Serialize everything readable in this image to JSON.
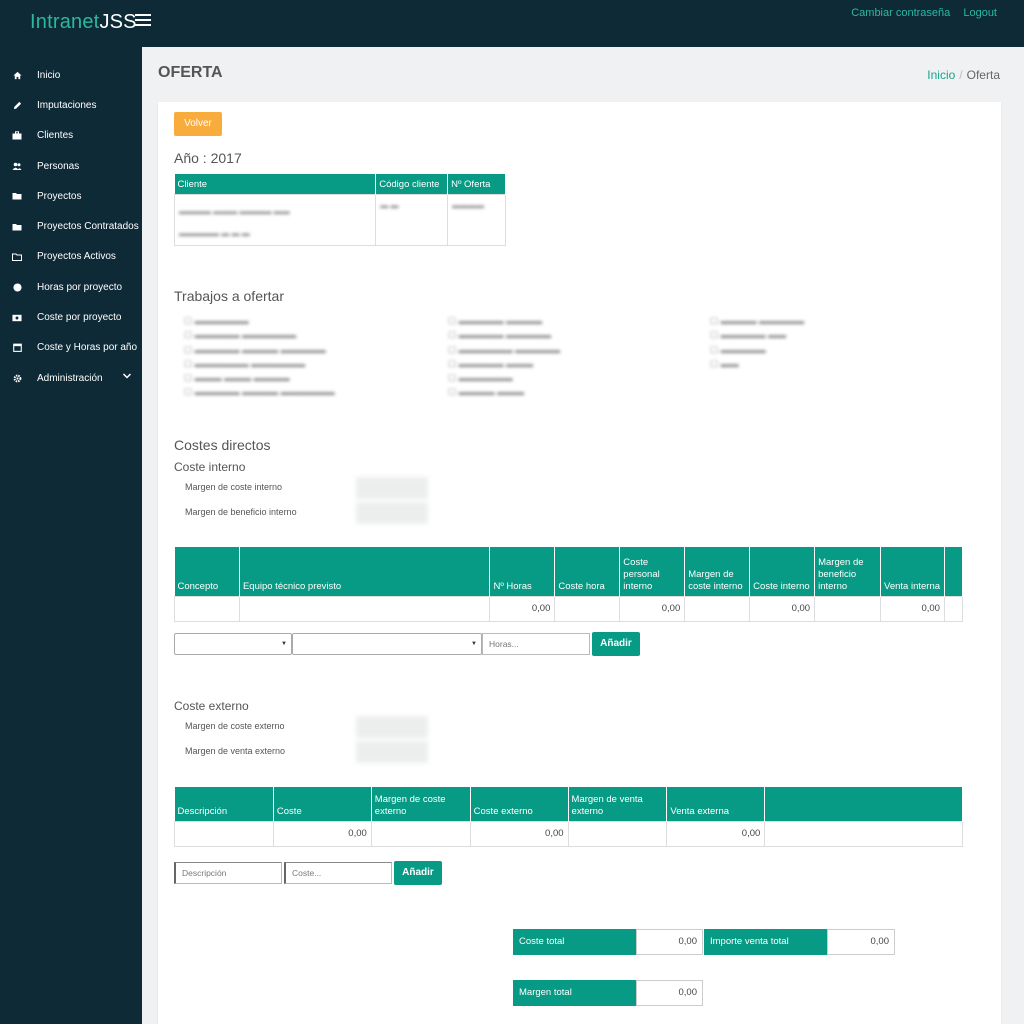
{
  "header": {
    "brand_prefix": "Intranet",
    "brand_suffix": "JSS",
    "change_password": "Cambiar contraseña",
    "logout": "Logout"
  },
  "sidebar": {
    "items": [
      {
        "label": "Inicio",
        "icon": "home-icon"
      },
      {
        "label": "Imputaciones",
        "icon": "pencil-icon"
      },
      {
        "label": "Clientes",
        "icon": "briefcase-icon"
      },
      {
        "label": "Personas",
        "icon": "users-icon"
      },
      {
        "label": "Proyectos",
        "icon": "folder-icon"
      },
      {
        "label": "Proyectos Contratados",
        "icon": "folder-icon"
      },
      {
        "label": "Proyectos Activos",
        "icon": "folder-open-icon"
      },
      {
        "label": "Horas por proyecto",
        "icon": "clock-icon"
      },
      {
        "label": "Coste por proyecto",
        "icon": "money-icon"
      },
      {
        "label": "Coste y Horas por año",
        "icon": "calendar-icon"
      },
      {
        "label": "Administración",
        "icon": "gear-icon"
      }
    ]
  },
  "page": {
    "title": "OFERTA",
    "breadcrumb_home": "Inicio",
    "breadcrumb_sep": "/",
    "breadcrumb_current": "Oferta"
  },
  "form": {
    "back_button": "Volver",
    "year_heading": "Año : 2017",
    "client_table": {
      "headers": [
        "Cliente",
        "Código cliente",
        "Nº Oferta"
      ]
    },
    "trabajos_heading": "Trabajos a ofertar",
    "costes_directos_heading": "Costes directos",
    "coste_interno_heading": "Coste interno",
    "margen_coste_interno_label": "Margen de coste interno",
    "margen_beneficio_interno_label": "Margen de beneficio interno",
    "internal_table": {
      "headers": [
        "Concepto",
        "Equipo técnico previsto",
        "Nº Horas",
        "Coste hora",
        "Coste personal interno",
        "Margen de coste interno",
        "Coste interno",
        "Margen de beneficio interno",
        "Venta interna",
        ""
      ],
      "row": [
        "",
        "",
        "0,00",
        "",
        "0,00",
        "",
        "0,00",
        "",
        "0,00",
        ""
      ]
    },
    "horas_placeholder": "Horas...",
    "add_button": "Añadir",
    "coste_externo_heading": "Coste externo",
    "margen_coste_externo_label": "Margen de coste externo",
    "margen_venta_externo_label": "Margen de venta externo",
    "external_table": {
      "headers": [
        "Descripción",
        "Coste",
        "Margen de coste externo",
        "Coste externo",
        "Margen de venta externo",
        "Venta externa",
        ""
      ],
      "row": [
        "",
        "0,00",
        "",
        "0,00",
        "",
        "0,00",
        ""
      ]
    },
    "descripcion_placeholder": "Descripción",
    "coste_placeholder": "Coste...",
    "coste_total_label": "Coste total",
    "coste_total_value": "0,00",
    "importe_venta_total_label": "Importe venta total",
    "importe_venta_total_value": "0,00",
    "margen_total_label": "Margen total",
    "margen_total_value": "0,00"
  },
  "colors": {
    "sidebar_bg": "#0f2a37",
    "accent_teal": "#079a84",
    "button_orange": "#f8ac3b"
  }
}
